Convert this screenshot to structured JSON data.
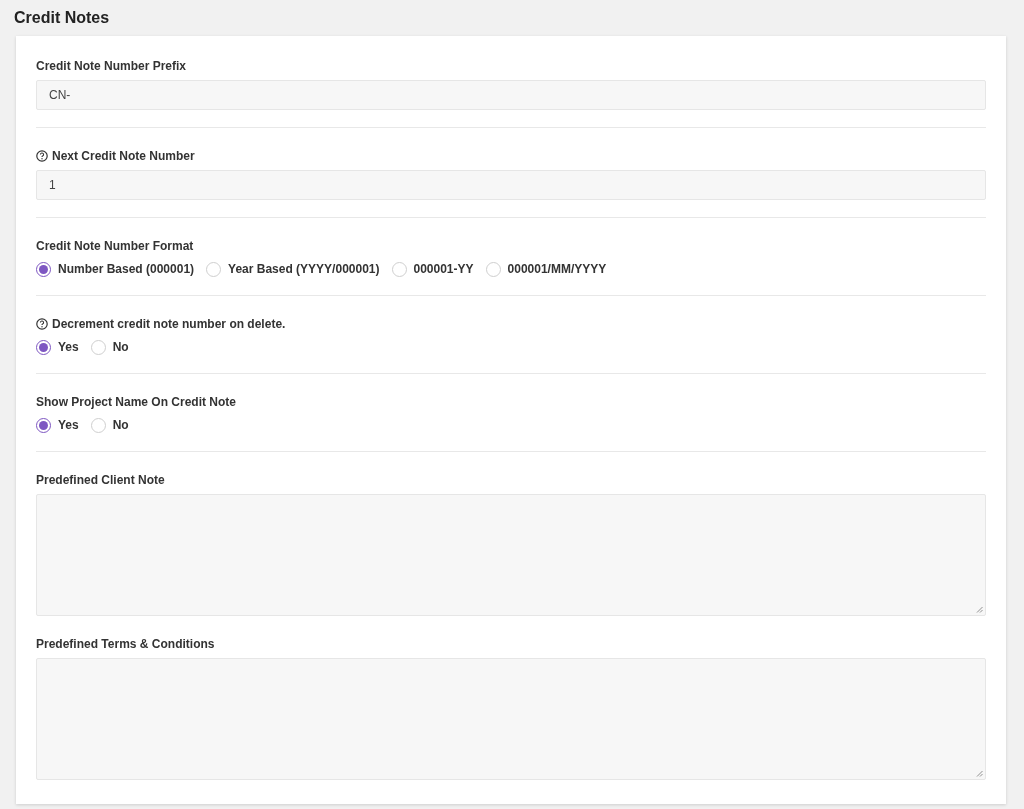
{
  "page_title": "Credit Notes",
  "sections": [
    {
      "kind": "text_input",
      "label": "Credit Note Number Prefix",
      "help": false,
      "value": "CN-"
    },
    {
      "kind": "text_input",
      "label": "Next Credit Note Number",
      "help": true,
      "value": "1"
    },
    {
      "kind": "radio",
      "label": "Credit Note Number Format",
      "help": false,
      "options": [
        {
          "label": "Number Based (000001)",
          "selected": true
        },
        {
          "label": "Year Based (YYYY/000001)",
          "selected": false
        },
        {
          "label": "000001-YY",
          "selected": false
        },
        {
          "label": "000001/MM/YYYY",
          "selected": false
        }
      ]
    },
    {
      "kind": "radio",
      "label": "Decrement credit note number on delete.",
      "help": true,
      "options": [
        {
          "label": "Yes",
          "selected": true
        },
        {
          "label": "No",
          "selected": false
        }
      ]
    },
    {
      "kind": "radio",
      "label": "Show Project Name On Credit Note",
      "help": false,
      "options": [
        {
          "label": "Yes",
          "selected": true
        },
        {
          "label": "No",
          "selected": false
        }
      ]
    },
    {
      "kind": "textarea",
      "label": "Predefined Client Note",
      "help": false
    },
    {
      "kind": "textarea",
      "label": "Predefined Terms & Conditions",
      "help": false
    }
  ]
}
